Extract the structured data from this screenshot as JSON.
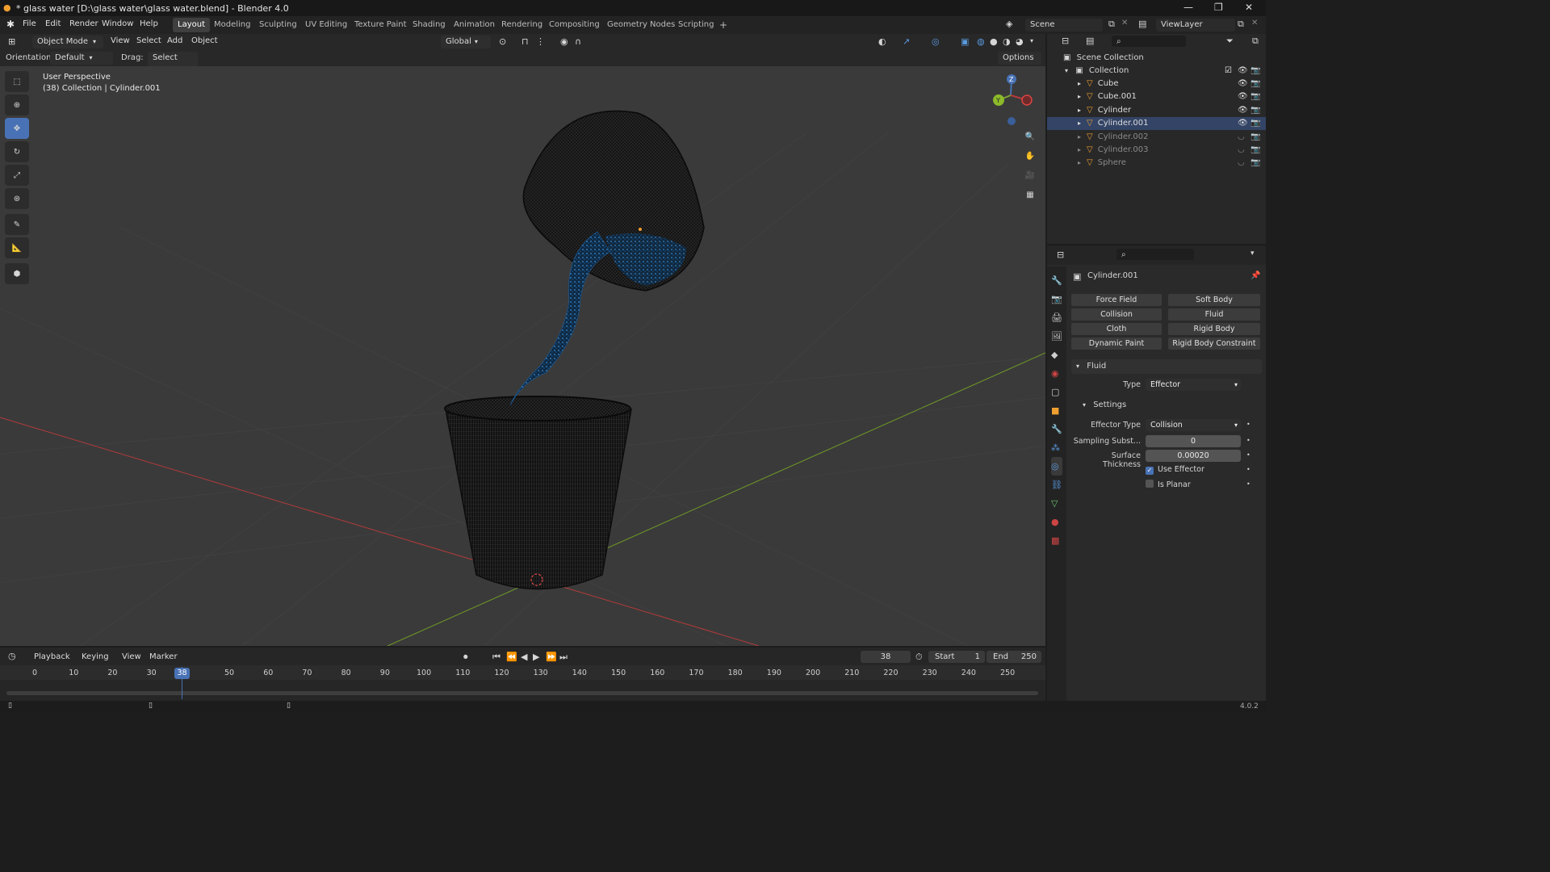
{
  "window": {
    "title": "* glass water [D:\\glass water\\glass water.blend] - Blender 4.0",
    "controls": [
      "—",
      "❐",
      "✕"
    ]
  },
  "menu": [
    "File",
    "Edit",
    "Render",
    "Window",
    "Help"
  ],
  "workspaces": [
    "Layout",
    "Modeling",
    "Sculpting",
    "UV Editing",
    "Texture Paint",
    "Shading",
    "Animation",
    "Rendering",
    "Compositing",
    "Geometry Nodes",
    "Scripting"
  ],
  "active_workspace": "Layout",
  "add_workspace": "+",
  "scene": {
    "name": "Scene",
    "view_layer": "ViewLayer"
  },
  "viewport_header": {
    "mode": "Object Mode",
    "menus": [
      "View",
      "Select",
      "Add",
      "Object"
    ],
    "transform": "Global",
    "orientation_label": "Orientation:",
    "orientation_value": "Default",
    "drag_label": "Drag:",
    "drag_value": "Select Box",
    "options": "Options"
  },
  "viewport": {
    "view_name": "User Perspective",
    "context": "(38) Collection | Cylinder.001",
    "gizmo": {
      "z": "Z",
      "y": "Y"
    }
  },
  "tools": [
    "select-box",
    "cursor",
    "move",
    "rotate",
    "scale",
    "transform",
    "annotate",
    "measure",
    "add-cube"
  ],
  "active_tool": "move",
  "outliner": {
    "root": "Scene Collection",
    "collection": "Collection",
    "objects": [
      {
        "name": "Cube",
        "visible": true,
        "selected": false
      },
      {
        "name": "Cube.001",
        "visible": true,
        "selected": false
      },
      {
        "name": "Cylinder",
        "visible": true,
        "selected": false
      },
      {
        "name": "Cylinder.001",
        "visible": true,
        "selected": true
      },
      {
        "name": "Cylinder.002",
        "visible": false,
        "selected": false
      },
      {
        "name": "Cylinder.003",
        "visible": false,
        "selected": false
      },
      {
        "name": "Sphere",
        "visible": false,
        "selected": false
      }
    ]
  },
  "properties": {
    "object_name": "Cylinder.001",
    "physics_buttons": [
      [
        "Force Field",
        "Soft Body"
      ],
      [
        "Collision",
        "Fluid"
      ],
      [
        "Cloth",
        "Rigid Body"
      ],
      [
        "Dynamic Paint",
        "Rigid Body Constraint"
      ]
    ],
    "fluid_panel": "Fluid",
    "type_label": "Type",
    "type_value": "Effector",
    "settings_panel": "Settings",
    "effector_type_label": "Effector Type",
    "effector_type_value": "Collision",
    "sampling_label": "Sampling Subst...",
    "sampling_value": "0",
    "surface_label": "Surface Thickness",
    "surface_value": "0.00020",
    "use_effector": {
      "label": "Use Effector",
      "checked": true
    },
    "is_planar": {
      "label": "Is Planar",
      "checked": false
    }
  },
  "timeline": {
    "menus": [
      "Playback",
      "Keying",
      "View",
      "Marker"
    ],
    "current_frame": "38",
    "start_label": "Start",
    "start_value": "1",
    "end_label": "End",
    "end_value": "250",
    "ticks": [
      "0",
      "10",
      "20",
      "30",
      "38",
      "50",
      "60",
      "70",
      "80",
      "90",
      "100",
      "110",
      "120",
      "130",
      "140",
      "150",
      "160",
      "170",
      "180",
      "190",
      "200",
      "210",
      "220",
      "230",
      "240",
      "250"
    ]
  },
  "status": {
    "version": "4.0.2"
  },
  "colors": {
    "accent": "#4872b5",
    "x_axis": "#b53a3a",
    "y_axis": "#6f9a26",
    "water": "#2a6fb0"
  }
}
